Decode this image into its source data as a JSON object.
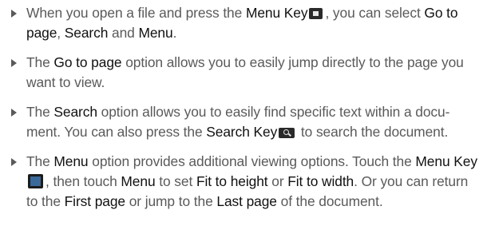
{
  "items": [
    {
      "p1": "When you open a file and press the ",
      "b1": "Menu Key",
      "icon1": "menu-key-icon",
      "p2": ", you can select ",
      "b2": "Go to page",
      "p3": ", ",
      "b3": "Search",
      "p4": " and ",
      "b4": "Menu",
      "p5": "."
    },
    {
      "p1": "The ",
      "b1": "Go to page",
      "p2": " option allows you to easily jump directly to the page you want to view."
    },
    {
      "p1": "The ",
      "b1": "Search",
      "p2": " option allows you to easily find specific text within a docu-ment. You can also press the ",
      "b2": "Search Key",
      "icon1": "search-key-icon",
      "p3": " to search the document."
    },
    {
      "p1": "The ",
      "b1": "Menu",
      "p2": " option provides additional viewing options. Touch the ",
      "b2": "Menu Key",
      "icon1": "menu-key-icon",
      "p3": ", then touch ",
      "b3": "Menu",
      "p4": " to set ",
      "b4": "Fit to height",
      "p5": " or ",
      "b5": "Fit to width",
      "p6": ". Or you can return to the ",
      "b6": "First page",
      "p7": " or jump to the ",
      "b7": "Last page",
      "p8": " of the document."
    }
  ]
}
